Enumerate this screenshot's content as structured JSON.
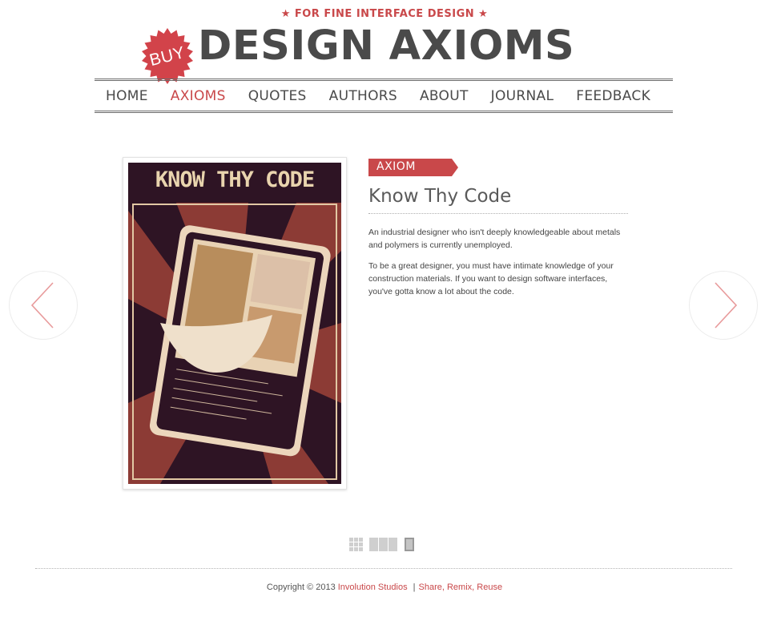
{
  "header": {
    "tagline": "★ FOR FINE INTERFACE DESIGN ★",
    "logo_text": "DESIGN AXIOMS",
    "buy_badge": "BUY"
  },
  "nav": {
    "items": [
      {
        "label": "HOME",
        "active": false
      },
      {
        "label": "AXIOMS",
        "active": true
      },
      {
        "label": "QUOTES",
        "active": false
      },
      {
        "label": "AUTHORS",
        "active": false
      },
      {
        "label": "ABOUT",
        "active": false
      },
      {
        "label": "JOURNAL",
        "active": false
      },
      {
        "label": "FEEDBACK",
        "active": false
      }
    ]
  },
  "slide": {
    "poster_title": "KNOW THY CODE",
    "tag": "AXIOM",
    "title": "Know Thy Code",
    "paragraphs": [
      "An industrial designer who isn't deeply knowledgeable about metals and polymers is currently unemployed.",
      "To be a great designer, you must have intimate knowledge of your construction materials. If you want to design software interfaces, you've gotta know a lot about the code."
    ]
  },
  "controls": {
    "prev_icon": "chevron-left-icon",
    "next_icon": "chevron-right-icon",
    "view_icons": [
      "grid-view-icon",
      "strip-view-icon",
      "single-view-icon"
    ]
  },
  "footer": {
    "copyright": "Copyright © 2013",
    "company_link": "Involution Studios",
    "separator": "|",
    "license_link": "Share, Remix, Reuse"
  },
  "colors": {
    "accent": "#c9484a",
    "text": "#4a4a4a"
  }
}
